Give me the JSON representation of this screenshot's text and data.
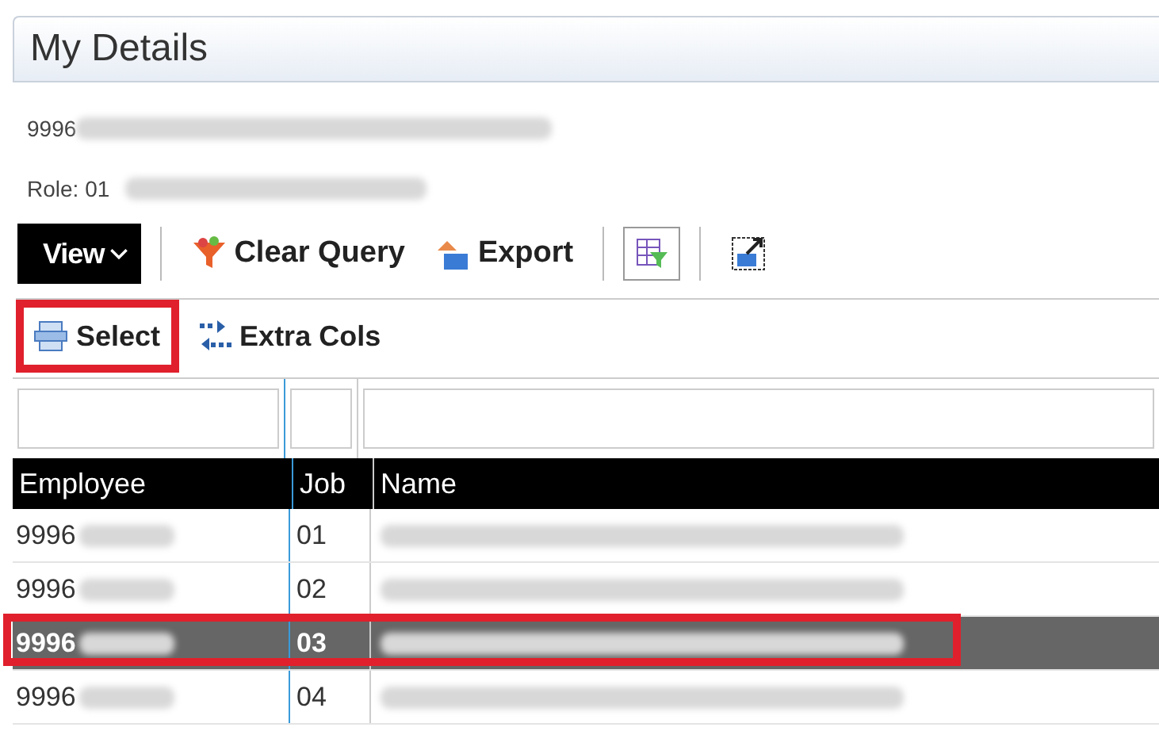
{
  "panel": {
    "title": "My Details",
    "id_line": "9996",
    "role_line": "Role: 01"
  },
  "toolbar": {
    "view_menu": "View",
    "buttons": [
      {
        "kind": "funnel",
        "label": "Clear Query"
      },
      {
        "kind": "export",
        "label": "Export"
      },
      {
        "kind": "filter-table"
      },
      {
        "kind": "chart-export"
      }
    ]
  },
  "subtoolbar": {
    "buttons": [
      {
        "kind": "select",
        "label": "Select",
        "highlighted": true
      },
      {
        "kind": "cols",
        "label": "Extra Cols",
        "highlighted": false
      }
    ]
  },
  "table": {
    "columns": [
      "Employee",
      "Job",
      "Name"
    ],
    "rows": [
      {
        "employee": "9996",
        "job": "01",
        "selected": false,
        "highlighted": false
      },
      {
        "employee": "9996",
        "job": "02",
        "selected": false,
        "highlighted": false
      },
      {
        "employee": "9996",
        "job": "03",
        "selected": true,
        "highlighted": true
      },
      {
        "employee": "9996",
        "job": "04",
        "selected": false,
        "highlighted": false
      }
    ]
  }
}
